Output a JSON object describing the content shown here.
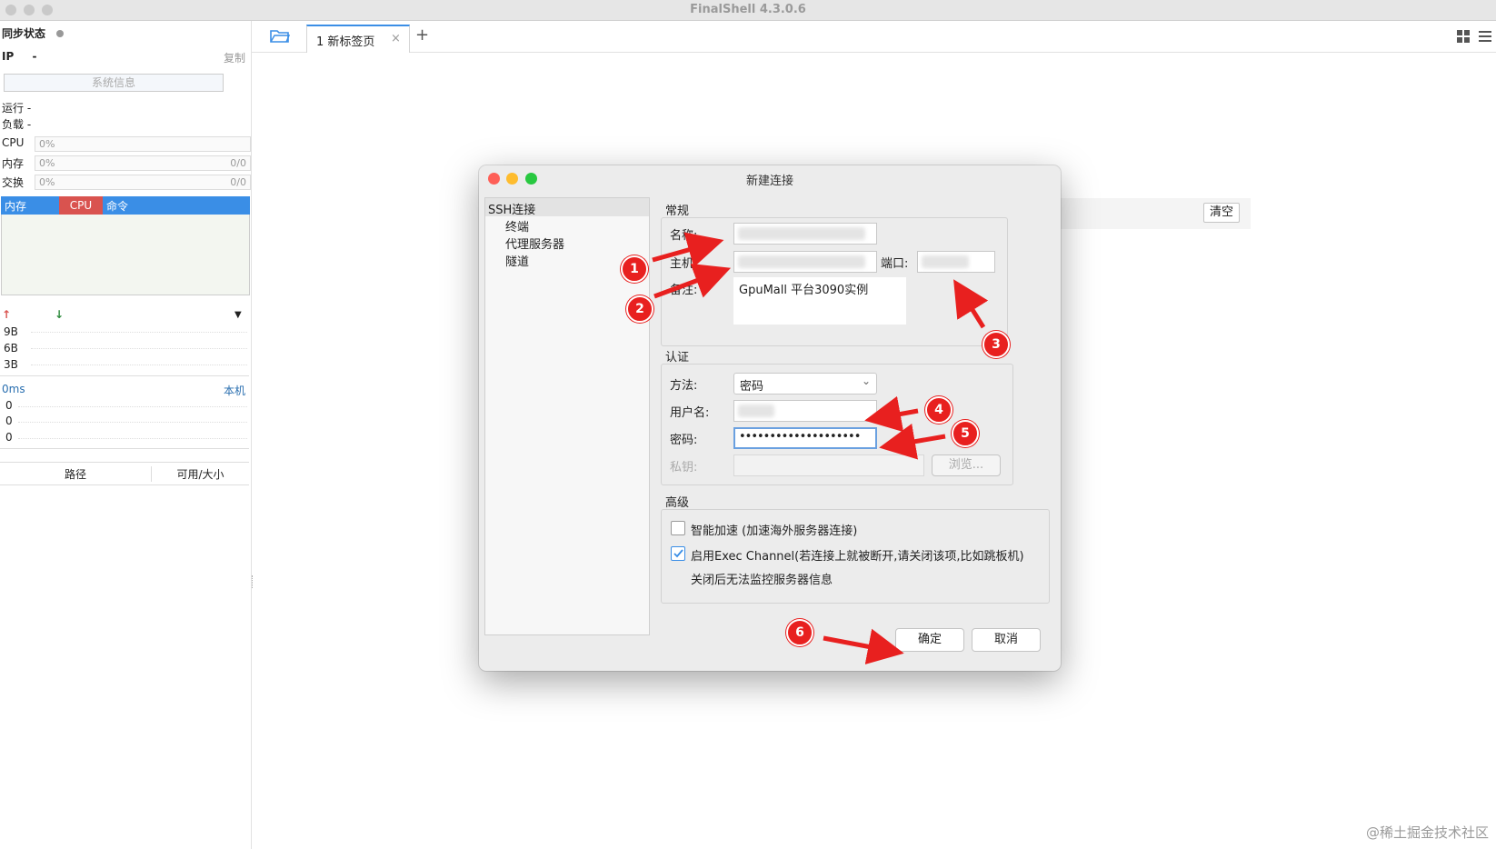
{
  "window": {
    "title": "FinalShell 4.3.0.6"
  },
  "sidebar": {
    "sync_status": "同步状态",
    "ip_label": "IP",
    "ip_value": "-",
    "copy": "复制",
    "sysinfo_button": "系统信息",
    "run_label": "运行 -",
    "load_label": "负载 -",
    "meters": [
      {
        "label": "CPU",
        "percent": "0%",
        "detail": ""
      },
      {
        "label": "内存",
        "percent": "0%",
        "detail": "0/0"
      },
      {
        "label": "交换",
        "percent": "0%",
        "detail": "0/0"
      }
    ],
    "proc_tabs": [
      "内存",
      "CPU",
      "命令"
    ],
    "net_scale": [
      "9B",
      "6B",
      "3B"
    ],
    "latency": "0ms",
    "host_local": "本机",
    "latency_vals": [
      "0",
      "0",
      "0"
    ],
    "disk_cols": [
      "路径",
      "可用/大小"
    ]
  },
  "tabs": {
    "active_label": "1 新标签页",
    "close": "×",
    "add": "+"
  },
  "main": {
    "clear_button": "清空"
  },
  "dialog": {
    "title": "新建连接",
    "tree": {
      "root": "SSH连接",
      "children": [
        "终端",
        "代理服务器",
        "隧道"
      ]
    },
    "general": {
      "group_label": "常规",
      "name_label": "名称:",
      "host_label": "主机:",
      "port_label": "端口:",
      "note_label": "备注:",
      "note_value": "GpuMall 平台3090实例"
    },
    "auth": {
      "group_label": "认证",
      "method_label": "方法:",
      "method_value": "密码",
      "user_label": "用户名:",
      "password_label": "密码:",
      "password_value": "••••••••••••••••••••",
      "key_label": "私钥:",
      "browse": "浏览..."
    },
    "advanced": {
      "group_label": "高级",
      "smart_accel": "智能加速 (加速海外服务器连接)",
      "smart_accel_checked": false,
      "exec_channel": "启用Exec Channel(若连接上就被断开,请关闭该项,比如跳板机)",
      "exec_channel_checked": true,
      "exec_note": "关闭后无法监控服务器信息"
    },
    "ok": "确定",
    "cancel": "取消"
  },
  "markers": [
    "1",
    "2",
    "3",
    "4",
    "5",
    "6"
  ],
  "watermark": "@稀土掘金技术社区",
  "colors": {
    "accent": "#3a8ee6",
    "cpu_tab": "#d9534f",
    "marker": "#e8201f"
  }
}
